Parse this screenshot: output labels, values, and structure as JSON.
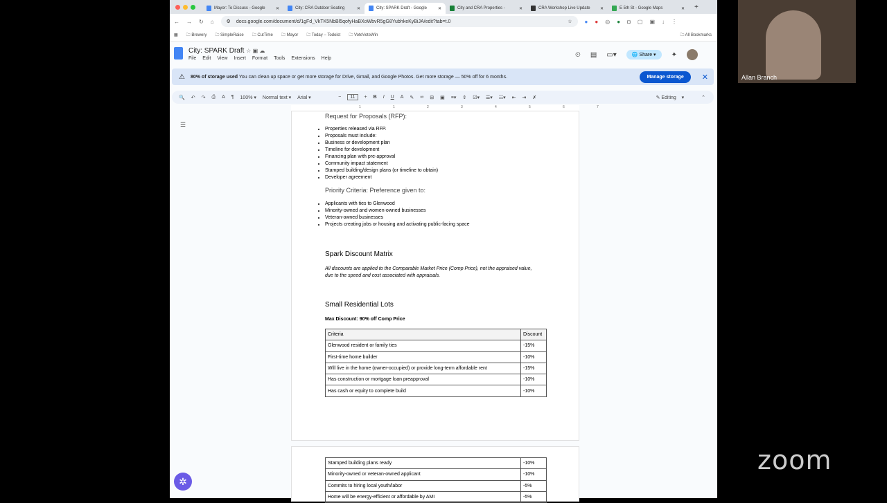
{
  "tabs": [
    {
      "label": "Mayor: To Discuss - Google",
      "color": "#4285f4"
    },
    {
      "label": "City: CRA Outdoor Seating",
      "color": "#4285f4"
    },
    {
      "label": "City: SPARK Draft - Google",
      "color": "#4285f4",
      "active": true
    },
    {
      "label": "City and CRA Properties -",
      "color": "#188038"
    },
    {
      "label": "CRA Workshop Live Update",
      "color": "#333"
    },
    {
      "label": "E 5th St - Google Maps",
      "color": "#34a853"
    }
  ],
  "url": "docs.google.com/document/d/1gFd_VkTK5NbBl5qofyHaBXoWbvR5gG8YubhkeKyBiJA/edit?tab=t.0",
  "bookmarks": [
    "Brewery",
    "SimpleRaise",
    "CutTime",
    "Mayor",
    "Today – Todoist",
    "VoteVoteWin"
  ],
  "all_bookmarks": "All Bookmarks",
  "doc": {
    "title": "City: SPARK Draft",
    "menu": [
      "File",
      "Edit",
      "View",
      "Insert",
      "Format",
      "Tools",
      "Extensions",
      "Help"
    ],
    "share": "Share"
  },
  "banner": {
    "bold": "80% of storage used",
    "text": "You can clean up space or get more storage for Drive, Gmail, and Google Photos. Get more storage — 50% off for 6 months.",
    "button": "Manage storage"
  },
  "toolbar": {
    "zoom": "100%",
    "style": "Normal text",
    "font": "Arial",
    "size": "11",
    "mode": "Editing"
  },
  "ruler": [
    "1",
    "1",
    "2",
    "3",
    "4",
    "5",
    "6",
    "7"
  ],
  "content": {
    "rfp_heading": "Request for Proposals (RFP):",
    "rfp_items": [
      "Properties released via RFP.",
      "Proposals must include:",
      "Business or development plan",
      "Timeline for development",
      "Financing plan with pre-approval",
      "Community impact statement",
      "Stamped building/design plans (or timeline to obtain)",
      "Developer agreement"
    ],
    "priority_heading": "Priority Criteria: Preference given to:",
    "priority_items": [
      "Applicants with ties to Glenwood",
      "Minority-owned and women-owned businesses",
      "Veteran-owned businesses",
      "Projects creating jobs or housing and activating public-facing space"
    ],
    "matrix_heading": "Spark Discount Matrix",
    "matrix_note": "All discounts are applied to the Comparable Market Price (Comp Price), not the appraised value, due to the speed and cost associated with appraisals.",
    "lots_heading": "Small Residential Lots",
    "max_discount": "Max Discount: 90% off Comp Price",
    "table_headers": [
      "Criteria",
      "Discount"
    ],
    "rows": [
      [
        "Glenwood resident or family ties",
        "-15%"
      ],
      [
        "First-time home builder",
        "-10%"
      ],
      [
        "Will live in the home (owner-occupied) or provide long-term affordable rent",
        "-15%"
      ],
      [
        "Has construction or mortgage loan preapproval",
        "-10%"
      ],
      [
        "Has cash or equity to complete build",
        "-10%"
      ]
    ],
    "rows2": [
      [
        "Stamped building plans ready",
        "-10%"
      ],
      [
        "Minority-owned or veteran-owned applicant",
        "-10%"
      ],
      [
        "Commits to hiring local youth/labor",
        "-5%"
      ],
      [
        "Home will be energy-efficient or affordable by AMI",
        "-5%"
      ]
    ]
  },
  "participant": "Allan Branch",
  "zoom_logo": "zoom"
}
